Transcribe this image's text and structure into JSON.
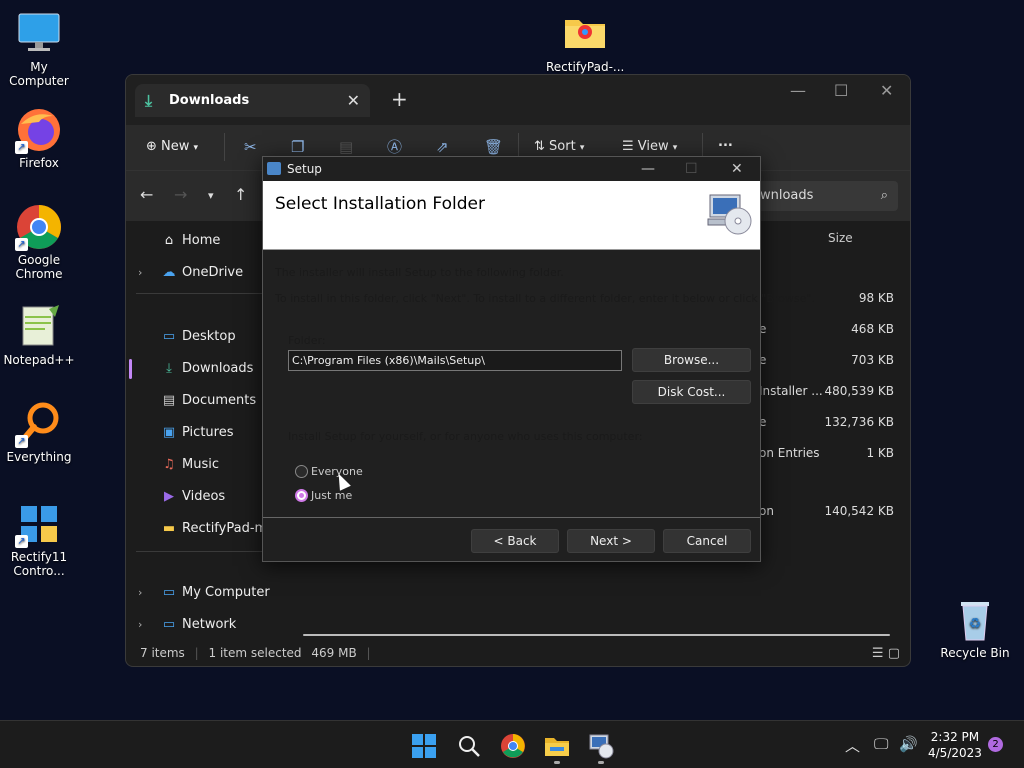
{
  "desktop": {
    "icons": [
      {
        "label": "My Computer"
      },
      {
        "label": "RectifyPad-..."
      },
      {
        "label": "Firefox"
      },
      {
        "label": "Google Chrome"
      },
      {
        "label": "Notepad++"
      },
      {
        "label": "Everything"
      },
      {
        "label": "Rectify11 Contro..."
      },
      {
        "label": "Recycle Bin"
      }
    ]
  },
  "explorer": {
    "tab_title": "Downloads",
    "toolbar": {
      "new_label": "New",
      "sort_label": "Sort",
      "view_label": "View",
      "more_label": "..."
    },
    "search_text": "wnloads",
    "sidebar": [
      {
        "label": "Home"
      },
      {
        "label": "OneDrive"
      },
      {
        "label": "Desktop"
      },
      {
        "label": "Downloads"
      },
      {
        "label": "Documents"
      },
      {
        "label": "Pictures"
      },
      {
        "label": "Music"
      },
      {
        "label": "Videos"
      },
      {
        "label": "RectifyPad-mai"
      },
      {
        "label": "My Computer"
      },
      {
        "label": "Network"
      }
    ],
    "size_header": "Size",
    "rows": [
      {
        "name": "",
        "size": "98 KB"
      },
      {
        "name": "e",
        "size": "468 KB"
      },
      {
        "name": "e",
        "size": "703 KB"
      },
      {
        "name": "Installer ...",
        "size": "480,539 KB"
      },
      {
        "name": "e",
        "size": "132,736 KB"
      },
      {
        "name": "on Entries",
        "size": "1 KB"
      },
      {
        "name": "on",
        "size": "140,542 KB"
      }
    ],
    "status": {
      "items": "7 items",
      "selected": "1 item selected",
      "selected_size": "469 MB"
    }
  },
  "setup": {
    "title": "Setup",
    "header": "Select Installation Folder",
    "line1": "The installer will install Setup to the following folder.",
    "line2": "To install in this folder, click \"Next\". To install to a different folder, enter it below or click \"Browse\".",
    "folder_label": "Folder:",
    "folder_value": "C:\\Program Files (x86)\\Mails\\Setup\\",
    "browse_label": "Browse...",
    "disk_cost_label": "Disk Cost...",
    "audience_text": "Install Setup for yourself, or for anyone who uses this computer:",
    "option_everyone": "Everyone",
    "option_justme": "Just me",
    "back_label": "< Back",
    "next_label": "Next >",
    "cancel_label": "Cancel"
  },
  "taskbar": {
    "time": "2:32 PM",
    "date": "4/5/2023",
    "notifications": "2"
  },
  "colors": {
    "accent": "#c488f7",
    "desktop_bg": "#0a0f24"
  }
}
